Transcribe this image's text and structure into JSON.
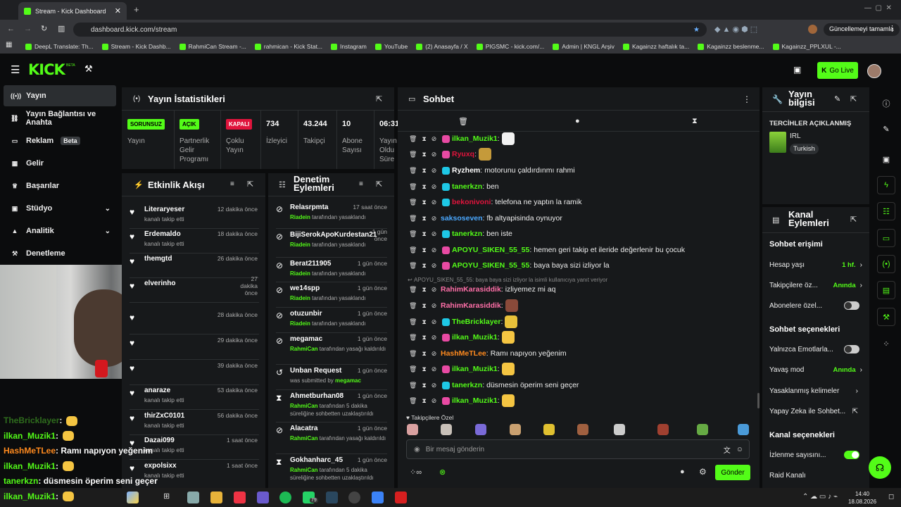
{
  "browser": {
    "tab_title": "Stream - Kick Dashboard",
    "url": "dashboard.kick.com/stream",
    "update_label": "Güncellemeyi tamamla",
    "bookmarks": [
      "DeepL Translate: Th...",
      "Stream - Kick Dashb...",
      "RahmiCan Stream -...",
      "rahmican - Kick Stat...",
      "Instagram",
      "YouTube",
      "(2) Anasayfa / X",
      "PIGSMC - kick.com/...",
      "Admin | KNGL Arşiv",
      "Kagainzz haftalık ta...",
      "Kagainzz beslenme...",
      "Kagainzz_PPLXUL -..."
    ]
  },
  "header": {
    "logo": "KICK",
    "beta": "BETA",
    "go_live": "Go Live"
  },
  "sidebar": [
    {
      "label": "Yayın",
      "icon": "broadcast-icon"
    },
    {
      "label": "Yayın Bağlantısı ve Anahta",
      "icon": "link-icon"
    },
    {
      "label": "Reklam",
      "badge": "Beta",
      "icon": "ad-icon"
    },
    {
      "label": "Gelir",
      "icon": "revenue-icon"
    },
    {
      "label": "Başarılar",
      "icon": "trophy-icon"
    },
    {
      "label": "Stüdyo",
      "icon": "studio-icon"
    },
    {
      "label": "Analitik",
      "icon": "analytics-icon"
    },
    {
      "label": "Denetleme",
      "icon": "moderation-icon"
    }
  ],
  "stats": {
    "title": "Yayın İstatistikleri",
    "items": [
      {
        "badge": "SORUNSUZ",
        "label": "Yayın",
        "type": "green"
      },
      {
        "badge": "AÇIK",
        "label": "Partnerlik Gelir Programı",
        "type": "green"
      },
      {
        "badge": "KAPALI",
        "label": "Çoklu Yayın",
        "type": "red"
      },
      {
        "value": "734",
        "label": "İzleyici"
      },
      {
        "value": "43.244",
        "label": "Takipçi"
      },
      {
        "value": "10",
        "label": "Abone Sayısı"
      },
      {
        "value": "06:31",
        "label": "Yayın Oldu Süre"
      }
    ]
  },
  "activity": {
    "title": "Etkinlik Akışı",
    "items": [
      {
        "name": "Literaryeser",
        "sub": "kanalı takip etti",
        "time": "12 dakika önce"
      },
      {
        "name": "Erdemaldo",
        "sub": "kanalı takip etti",
        "time": "18 dakika önce"
      },
      {
        "name": "themgtd",
        "sub": "",
        "time": "26 dakika önce"
      },
      {
        "name": "elverinho",
        "sub": "",
        "time": "27 dakika önce"
      },
      {
        "name": "",
        "sub": "",
        "time": "28 dakika önce"
      },
      {
        "name": "",
        "sub": "",
        "time": "29 dakika önce"
      },
      {
        "name": "",
        "sub": "",
        "time": "39 dakika önce"
      },
      {
        "name": "anaraze",
        "sub": "kanalı takip etti",
        "time": "53 dakika önce"
      },
      {
        "name": "thirZxC0101",
        "sub": "kanalı takip etti",
        "time": "56 dakika önce"
      },
      {
        "name": "Dazai099",
        "sub": "kanalı takip etti",
        "time": "1 saat önce"
      },
      {
        "name": "expolsixx",
        "sub": "kanalı takip etti",
        "time": "1 saat önce"
      }
    ]
  },
  "moderation": {
    "title": "Denetim Eylemleri",
    "items": [
      {
        "name": "Relasrpmta",
        "by": "Riadein",
        "sub": "tarafından yasaklandı",
        "time": "17 saat önce",
        "icon": "ban-icon"
      },
      {
        "name": "BijiSerokApoKurdestan21",
        "by": "Riadein",
        "sub": "tarafından yasaklandı",
        "time": "1 gün önce",
        "icon": "ban-icon"
      },
      {
        "name": "Berat211905",
        "by": "Riadein",
        "sub": "tarafından yasaklandı",
        "time": "1 gün önce",
        "icon": "ban-icon"
      },
      {
        "name": "we14spp",
        "by": "Riadein",
        "sub": "tarafından yasaklandı",
        "time": "1 gün önce",
        "icon": "ban-icon"
      },
      {
        "name": "otuzunbir",
        "by": "Riadein",
        "sub": "tarafından yasaklandı",
        "time": "1 gün önce",
        "icon": "ban-icon"
      },
      {
        "name": "megamac",
        "by": "RahmiCan",
        "sub": "tarafından yasağı kaldırıldı",
        "time": "1 gün önce",
        "icon": "ban-icon"
      },
      {
        "name": "Unban Request",
        "by": "megamac",
        "sub": "was submitted by",
        "time": "1 gün önce",
        "icon": "history-icon"
      },
      {
        "name": "Ahmetburhan08",
        "by": "RahmiCan",
        "sub": "tarafından 5 dakika süreliğine sohbetten uzaklaştırıldı",
        "time": "1 gün önce",
        "icon": "hourglass-icon"
      },
      {
        "name": "Alacatra",
        "by": "RahmiCan",
        "sub": "tarafından yasağı kaldırıldı",
        "time": "1 gün önce",
        "icon": "ban-icon"
      },
      {
        "name": "Gokhanharc_45",
        "by": "RahmiCan",
        "sub": "tarafından 5 dakika süreliğine sohbetten uzaklaştırıldı",
        "time": "1 gün önce",
        "icon": "hourglass-icon"
      }
    ]
  },
  "chat": {
    "title": "Sohbet",
    "reply_note": "APOYU_SIKEN_55_55: baya baya sizi izliyor la isimli kullanıcıya yanıt veriyor",
    "followers_label": "Takipçilere Özel",
    "placeholder": "Bir mesaj gönderin",
    "send": "Gönder",
    "messages": [
      {
        "user": "ilkan_Muzik1",
        "text": "",
        "color": "#53fc18",
        "badge": "#e84aa3",
        "emote": "#f2f2f2"
      },
      {
        "user": "Ryuxq",
        "text": "",
        "color": "#e0143c",
        "badge": "#e84aa3",
        "emote": "#c59a3a"
      },
      {
        "user": "Ryzhem",
        "text": "motorunu çaldırdınmı rahmi",
        "color": "#ffffff",
        "badge": "#1ec8e6"
      },
      {
        "user": "tanerkzn",
        "text": "ben",
        "color": "#53fc18",
        "badge": "#1ec8e6"
      },
      {
        "user": "bekonivoni",
        "text": "telefona ne yaptın la ramik",
        "color": "#e0143c",
        "badge": "#1ec8e6"
      },
      {
        "user": "saksoseven",
        "text": "fb altyapisinda oynuyor",
        "color": "#4aa8ff",
        "badge": ""
      },
      {
        "user": "tanerkzn",
        "text": "ben iste",
        "color": "#53fc18",
        "badge": "#1ec8e6"
      },
      {
        "user": "APOYU_SIKEN_55_55",
        "text": "hemen geri takip et ileride değerlenir bu çocuk",
        "color": "#53fc18",
        "badge": "#e84aa3"
      },
      {
        "user": "APOYU_SIKEN_55_55",
        "text": "baya baya sizi izliyor la",
        "color": "#53fc18",
        "badge": "#e84aa3"
      },
      {
        "user": "RahimKarasiddik",
        "text": "izliyemez mi aq",
        "color": "#ff6fa8",
        "badge": ""
      },
      {
        "user": "RahimKarasiddik",
        "text": "",
        "color": "#ff6fa8",
        "badge": "",
        "emote": "#8a4a3a"
      },
      {
        "user": "TheBricklayer",
        "text": "",
        "color": "#53fc18",
        "badge": "#1ec8e6",
        "emote": "#e8c13a"
      },
      {
        "user": "ilkan_Muzik1",
        "text": "",
        "color": "#53fc18",
        "badge": "#e84aa3",
        "emote": "#f5c542"
      },
      {
        "user": "HashMeTLee",
        "text": "Ramı napıyon yeğenim",
        "color": "#ff8a1e",
        "badge": ""
      },
      {
        "user": "ilkan_Muzik1",
        "text": "",
        "color": "#53fc18",
        "badge": "#e84aa3",
        "emote": "#f5c542"
      },
      {
        "user": "tanerkzn",
        "text": "düsmesin öperim seni geçer",
        "color": "#53fc18",
        "badge": "#1ec8e6"
      },
      {
        "user": "ilkan_Muzik1",
        "text": "",
        "color": "#53fc18",
        "badge": "#e84aa3",
        "emote": "#f5c542"
      }
    ]
  },
  "info": {
    "title": "Yayın bilgisi",
    "prefs": "TERCİHLER AÇIKLANMIŞ",
    "category": "IRL",
    "language": "Turkish"
  },
  "channel": {
    "title": "Kanal Eylemleri",
    "chat_access": "Sohbet erişimi",
    "account_age": "Hesap yaşı",
    "account_age_val": "1 hf.",
    "followers_only": "Takipçilere öz...",
    "followers_only_val": "Anında",
    "subs": "Abonelere özel...",
    "chat_options": "Sohbet seçenekleri",
    "emote_only": "Yalnızca Emotlarla...",
    "slow": "Yavaş mod",
    "slow_val": "Anında",
    "banned_words": "Yasaklanmış kelimeler",
    "ai": "Yapay Zeka ile Sohbet...",
    "channel_options": "Kanal seçenekleri",
    "viewer_count": "İzlenme sayısını...",
    "raid": "Raid Kanalı"
  },
  "overlay": [
    {
      "user": "TheBricklayer",
      "text": ":",
      "color": "#2f6d1d"
    },
    {
      "user": "ilkan_Muzik1",
      "text": ":",
      "color": "#53fc18"
    },
    {
      "user": "HashMeTLee",
      "text": ": Ramı napıyon yeğenim",
      "color": "#ff8a1e"
    },
    {
      "user": "ilkan_Muzik1",
      "text": ":",
      "color": "#53fc18"
    },
    {
      "user": "tanerkzn",
      "text": ": düsmesin öperim seni geçer",
      "color": "#53fc18"
    },
    {
      "user": "ilkan_Muzik1",
      "text": ":",
      "color": "#53fc18"
    }
  ],
  "taskbar": {
    "time": "14:40",
    "date": "18.08.2026",
    "badge": "79"
  }
}
